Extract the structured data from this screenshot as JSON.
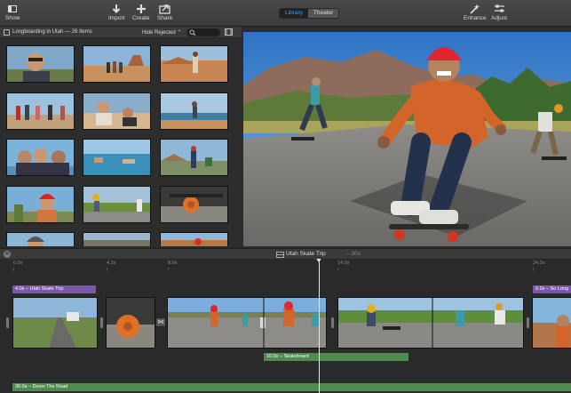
{
  "toolbar": {
    "show_label": "Show",
    "import_label": "Import",
    "create_label": "Create",
    "share_label": "Share",
    "enhance_label": "Enhance",
    "adjust_label": "Adjust",
    "tabs": [
      {
        "label": "Library",
        "active": true
      },
      {
        "label": "Theater",
        "active": false
      }
    ]
  },
  "browser": {
    "album_title": "Longboarding in Utah",
    "item_count": "26 Items",
    "filter_label": "Hide Rejected",
    "filter_chevron": "⌃",
    "search_placeholder": ""
  },
  "timeline": {
    "project_title": "Utah Skate Trip",
    "project_duration": "– 30s",
    "ruler": [
      "0.0s",
      "4.3s",
      "8.0s",
      "14.0s",
      "24.0s"
    ],
    "titles": [
      {
        "label": "4.0s – Utah Skate Trip"
      },
      {
        "label": "5.0s – So Long"
      }
    ],
    "audio": [
      {
        "label": "10.0s – Skateboard"
      },
      {
        "label": "30.0s – Down The Road"
      }
    ],
    "transition_label": "⋈"
  },
  "colors": {
    "accent": "#3da0e8",
    "title_clip": "#7a57a8",
    "audio_clip": "#4f8a4f"
  }
}
